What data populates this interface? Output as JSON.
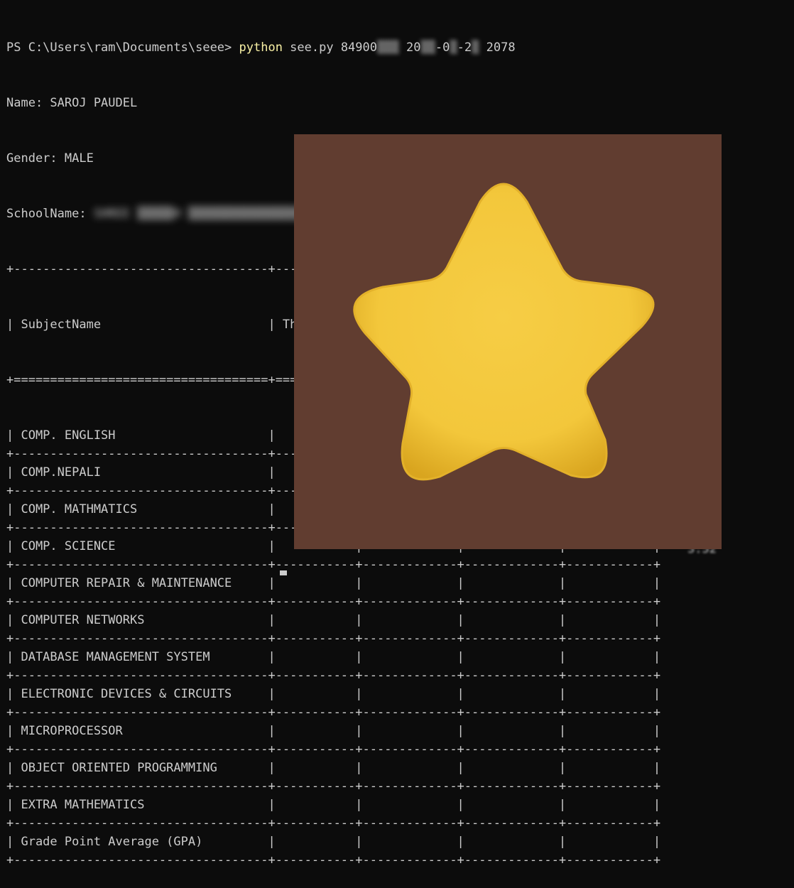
{
  "prompt": {
    "path": "PS C:\\Users\\ram\\Documents\\seee> ",
    "command": "python",
    "args_prefix": " see.py 84900",
    "args_redacted_1": "▒▒▒",
    "args_mid": " 20",
    "args_redacted_2": "▒▒",
    "args_mid2": "-0",
    "args_redacted_3": "▒",
    "args_mid3": "-2",
    "args_redacted_4": "▒",
    "args_suffix": " 2078"
  },
  "student": {
    "name_line": "Name: SAROJ PAUDEL",
    "gender_line": "Gender: MALE",
    "school_label": "SchoolName: ",
    "school_redacted": "SHREE ▒▒▒▒▒H ▒▒▒▒▒▒▒▒▒▒▒▒▒▒▒▒▒▒A"
  },
  "table": {
    "border_line": "+-----------------------------------+-----------+-------------+-------------+------------+",
    "header_sep": "+===================================+===========+=============+=============+============+",
    "header_row": "| SubjectName                       | Theory    | Practical   | TotalGrade  |   TotalGPA |",
    "rows": [
      "| COMP. ENGLISH                     |           |             |             |            |",
      "| COMP.NEPALI                       |           |             |             |            |",
      "| COMP. MATHMATICS                  |           |             |             |            |",
      "| COMP. SCIENCE                     |           |             |             |            |",
      "| COMPUTER REPAIR & MAINTENANCE     |           |             |             |            |",
      "| COMPUTER NETWORKS                 |           |             |             |            |",
      "| DATABASE MANAGEMENT SYSTEM        |           |             |             |            |",
      "| ELECTRONIC DEVICES & CIRCUITS     |           |             |             |            |",
      "| MICROPROCESSOR                    |           |             |             |            |",
      "| OBJECT ORIENTED PROGRAMMING       |           |             |             |            |",
      "| EXTRA MATHEMATICS                 |           |             |             |            |",
      "| Grade Point Average (GPA)         |           |             |             |            |"
    ],
    "gpa_peek": "3.52"
  },
  "colors": {
    "background": "#0c0c0c",
    "text": "#cccccc",
    "command": "#f9f1a5",
    "overlay_bg": "#613d30",
    "star": "#f5c73a"
  },
  "icons": {
    "overlay": "star-icon"
  }
}
